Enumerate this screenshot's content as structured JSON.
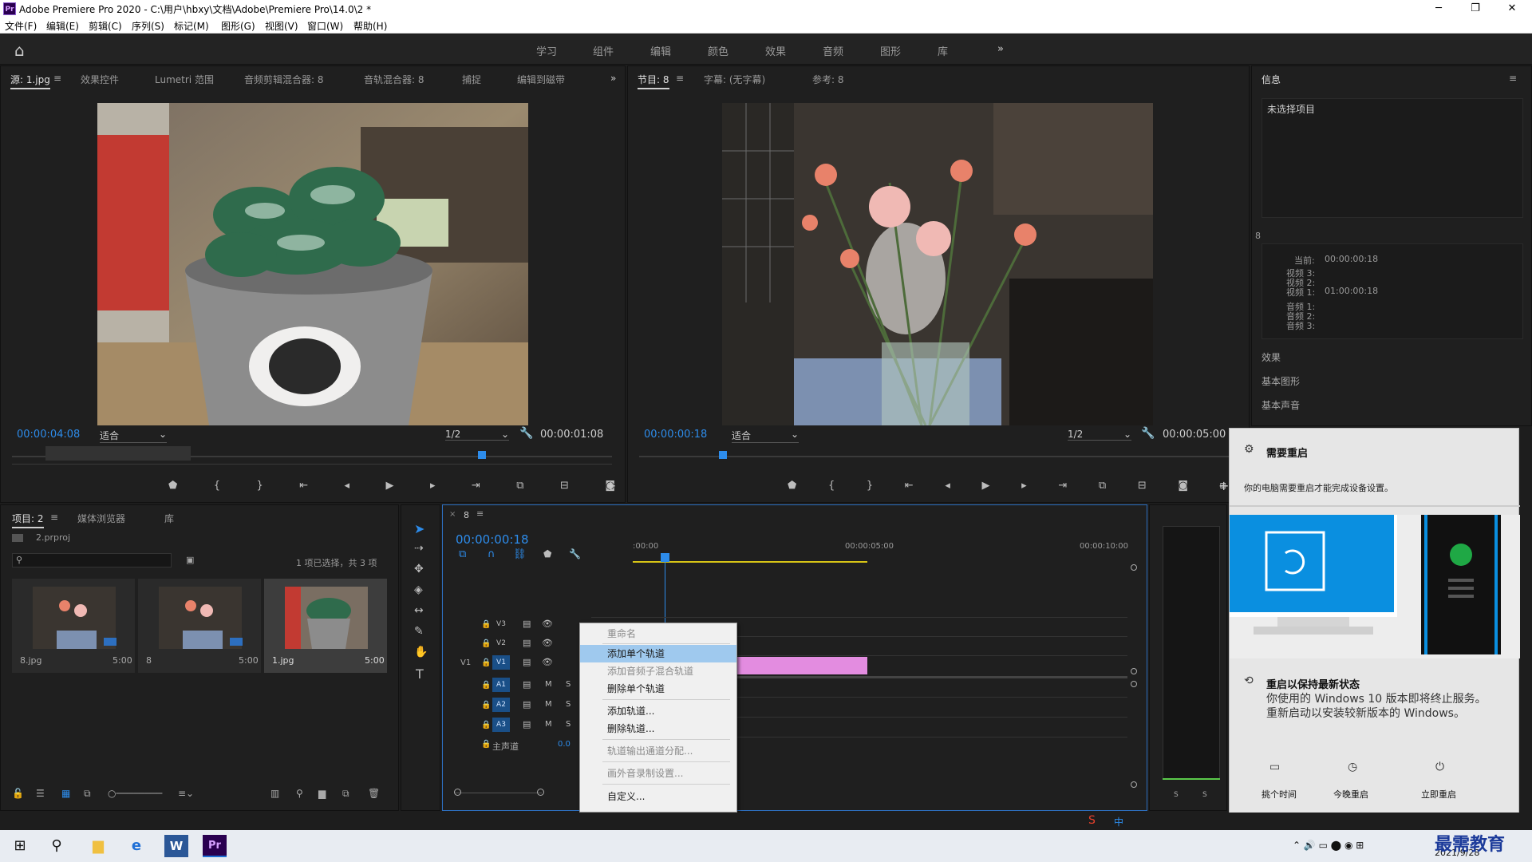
{
  "window": {
    "title": "Adobe Premiere Pro 2020 - C:\\用户\\hbxy\\文档\\Adobe\\Premiere Pro\\14.0\\2 *",
    "logo": "Pr",
    "minimize": "─",
    "maximize": "❐",
    "close": "✕"
  },
  "menu": [
    "文件(F)",
    "编辑(E)",
    "剪辑(C)",
    "序列(S)",
    "标记(M)",
    "图形(G)",
    "视图(V)",
    "窗口(W)",
    "帮助(H)"
  ],
  "workspaces": [
    "学习",
    "组件",
    "编辑",
    "颜色",
    "效果",
    "音频",
    "图形",
    "库"
  ],
  "icons": {
    "home": "⌂",
    "more": "»",
    "hamburger": "≡"
  },
  "source": {
    "tabs": [
      "源: 1.jpg",
      "效果控件",
      "Lumetri 范围",
      "音频剪辑混合器: 8",
      "音轨混合器: 8",
      "捕捉",
      "编辑到磁带"
    ],
    "timecode": "00:00:04:08",
    "fit": "适合",
    "resolution": "1/2",
    "duration": "00:00:01:08"
  },
  "program": {
    "tabs": [
      "节目: 8",
      "字幕: (无字幕)",
      "参考: 8"
    ],
    "timecode": "00:00:00:18",
    "fit": "适合",
    "resolution": "1/2",
    "duration": "00:00:05:00"
  },
  "info": {
    "title": "信息",
    "no_selection": "未选择项目",
    "seq_name": "8",
    "current_label": "当前:",
    "current_value": "00:00:00:18",
    "video3": "视频 3:",
    "video2": "视频 2:",
    "video1": "视频 1:",
    "video1_value": "01:00:00:18",
    "audio1": "音频 1:",
    "audio2": "音频 2:",
    "audio3": "音频 3:",
    "sections": [
      "效果",
      "基本图形",
      "基本声音"
    ]
  },
  "project": {
    "tabs": [
      "项目: 2",
      "媒体浏览器",
      "库"
    ],
    "file": "2.prproj",
    "status": "1 项已选择，共 3 项",
    "items": [
      {
        "name": "8.jpg",
        "duration": "5:00"
      },
      {
        "name": "8",
        "duration": "5:00"
      },
      {
        "name": "1.jpg",
        "duration": "5:00"
      }
    ]
  },
  "timeline": {
    "seq_name": "8",
    "timecode": "00:00:00:18",
    "ruler": [
      ":00:00",
      "00:00:05:00",
      "00:00:10:00"
    ],
    "tracks": [
      "V3",
      "V2",
      "V1",
      "A1",
      "A2",
      "A3"
    ],
    "v1_left": "V1",
    "master": "主声道",
    "master_value": "0.0",
    "m": "M",
    "s": "S"
  },
  "context_menu": [
    {
      "label": "重命名",
      "state": "disabled"
    },
    {
      "label": "添加单个轨道",
      "state": "highlighted"
    },
    {
      "label": "添加音频子混合轨道",
      "state": "disabled"
    },
    {
      "label": "删除单个轨道",
      "state": "normal"
    },
    {
      "label": "添加轨道...",
      "state": "normal"
    },
    {
      "label": "删除轨道...",
      "state": "normal"
    },
    {
      "label": "轨道输出通道分配...",
      "state": "disabled"
    },
    {
      "label": "画外音录制设置...",
      "state": "disabled"
    },
    {
      "label": "自定义...",
      "state": "normal"
    }
  ],
  "meter": {
    "s1": "S",
    "s2": "S"
  },
  "notification": {
    "title": "需要重启",
    "body": "你的电脑需要重启才能完成设备设置。",
    "heading2": "重启以保持最新状态",
    "body2": "你使用的 Windows 10 版本即将终止服务。 重新启动以安装较新版本的 Windows。",
    "actions": [
      "挑个时间",
      "今晚重启",
      "立即重启"
    ]
  },
  "taskbar": {
    "date": "2021/9/28",
    "watermark": "最需教育",
    "ime": "中",
    "win": "⊞",
    "search": "⚲",
    "folder": "▆",
    "edge": "e",
    "word": "W",
    "pr": "Pr"
  },
  "colors": {
    "accent": "#2d8ceb",
    "clip": "#e38ce0",
    "ruler_yellow": "#d7c416",
    "notice_blue": "#0078d7"
  }
}
